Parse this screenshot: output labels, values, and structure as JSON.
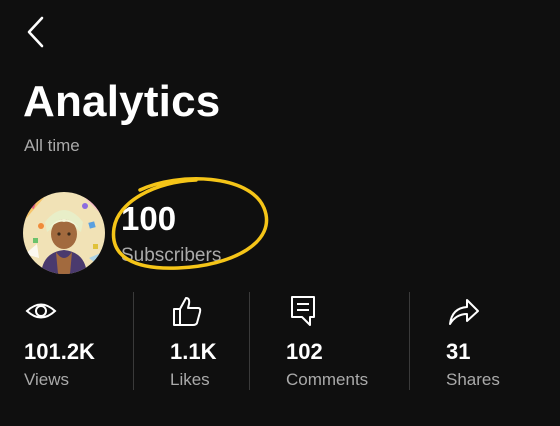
{
  "header": {
    "title": "Analytics",
    "subtitle": "All time"
  },
  "channel": {
    "subscriber_count": "100",
    "subscriber_label": "Subscribers",
    "highlight_color": "#f5c518"
  },
  "stats": [
    {
      "icon": "eye-icon",
      "value": "101.2K",
      "label": "Views"
    },
    {
      "icon": "thumbs-up-icon",
      "value": "1.1K",
      "label": "Likes"
    },
    {
      "icon": "comment-icon",
      "value": "102",
      "label": "Comments"
    },
    {
      "icon": "share-icon",
      "value": "31",
      "label": "Shares"
    }
  ],
  "colors": {
    "background": "#0f0f0f",
    "text_primary": "#ffffff",
    "text_secondary": "#aaaaaa",
    "divider": "#3a3a3a"
  }
}
